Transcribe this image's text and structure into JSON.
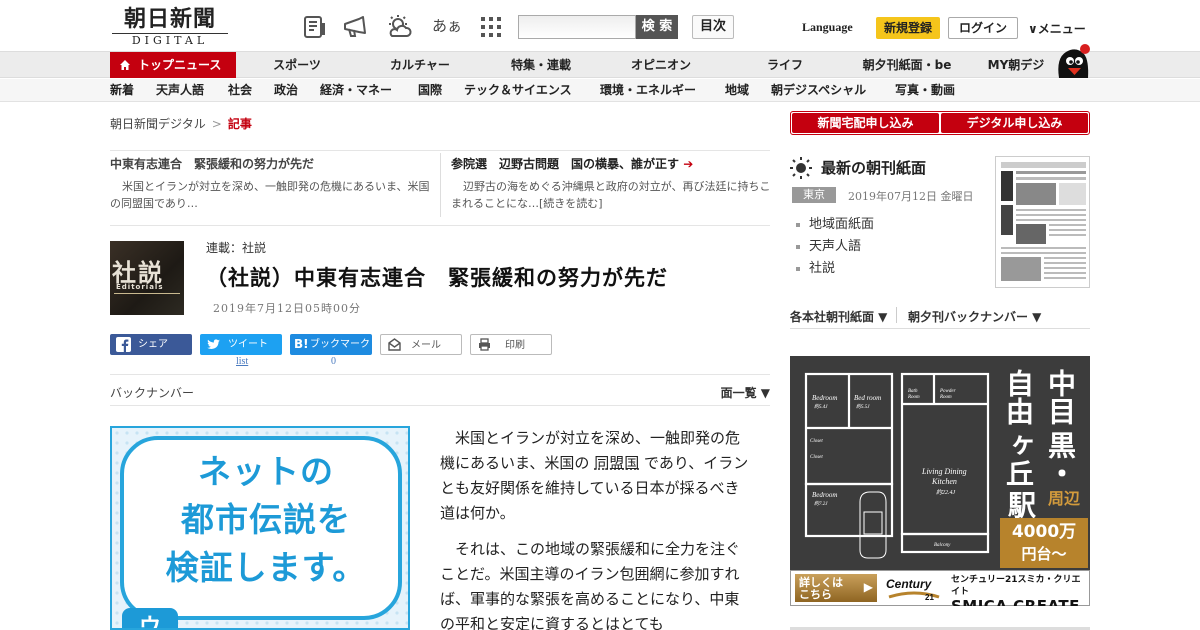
{
  "header": {
    "logo_kanji": "朝日新聞",
    "logo_digital": "DIGITAL",
    "icons": [
      "newspaper-icon",
      "megaphone-icon",
      "weather-icon",
      "font-size-icon",
      "grid-icon"
    ],
    "font_size_label": "あぁ",
    "search_placeholder": "",
    "search_button": "検 索",
    "toc_button": "目次",
    "language": "Language",
    "register": "新規登録",
    "login": "ログイン",
    "menu": "∨メニュー"
  },
  "nav_primary": [
    "トップニュース",
    "スポーツ",
    "カルチャー",
    "特集・連載",
    "オピニオン",
    "ライフ",
    "朝夕刊紙面・be",
    "MY朝デジ"
  ],
  "nav_secondary": [
    "新着",
    "天声人語",
    "社会",
    "政治",
    "経済・マネー",
    "国際",
    "テック＆サイエンス",
    "環境・エネルギー",
    "地域",
    "朝デジスペシャル",
    "写真・動画"
  ],
  "breadcrumb": {
    "home": "朝日新聞デジタル",
    "sep": ">",
    "current": "記事"
  },
  "related": [
    {
      "title": "中東有志連合　緊張緩和の努力が先だ",
      "desc": "米国とイランが対立を深め、一触即発の危機にあるいま、米国の同盟国であり…"
    },
    {
      "title": "参院選　辺野古問題　国の横暴、誰が正す",
      "desc": "辺野古の海をめぐる沖縄県と政府の対立が、再び法廷に持ちこまれることにな…[続きを読む]"
    }
  ],
  "article": {
    "thumb_text": "社説",
    "thumb_sub": "Editorials",
    "series": "連載：社説",
    "title": "（社説）中東有志連合　緊張緩和の努力が先だ",
    "date": "2019年7月12日05時00分",
    "back_number": "バックナンバー",
    "page_list": "面一覧 ▼",
    "body_p1_a": "米国とイランが対立を深め、一触即発の危機にあるいま、米国の",
    "body_p1_link": "同盟国",
    "body_p1_b": "であり、イランとも友好関係を維持している日本が採るべき道は何か。",
    "body_p2": "それは、この地域の緊張緩和に全力を注ぐことだ。米国主導のイラン包囲網に参加すれば、軍事的な緊張を高めることにな",
    "body_p2_cut": "り、中東の平和と安定に資するとはとても"
  },
  "share": {
    "facebook": "シェア",
    "twitter": "ツイート",
    "twitter_count": "list",
    "hatena": "ブックマーク",
    "hatena_count": "0",
    "mail": "メール",
    "print": "印刷"
  },
  "ad_left": {
    "lines": [
      "ネットの",
      "都市伝説を",
      "検証します。"
    ],
    "corner": "ウ"
  },
  "sidebar": {
    "subscribe_paper": "新聞宅配申し込み",
    "subscribe_digital": "デジタル申し込み",
    "paper_title": "最新の朝刊紙面",
    "paper_location": "東京",
    "paper_date": "2019年07月12日 金曜日",
    "paper_links": [
      "地域面紙面",
      "天声人語",
      "社説"
    ],
    "archive_1": "各本社朝刊紙面 ▼",
    "archive_2": "朝夕刊バックナンバー ▼"
  },
  "ad_right": {
    "vertical_lines": [
      "中目",
      "黒・",
      "自由",
      "ヶ丘",
      "駅"
    ],
    "area_suffix": "周辺",
    "price": "4000万",
    "price_suffix": "円台〜",
    "detail": "詳しくは\nこちら",
    "company_small": "センチュリー21スミカ・クリエイト",
    "company_big": "SMICA CREATE",
    "room_labels": [
      "Bedroom",
      "Bedroom",
      "Bedroom",
      "Living Dining Kitchen",
      "Bath Room",
      "Powder Room",
      "Balcony",
      "Closet"
    ]
  },
  "colors": {
    "brand_red": "#c4000f",
    "accent_yellow": "#f5c51b",
    "link_blue": "#1d9ad7"
  }
}
